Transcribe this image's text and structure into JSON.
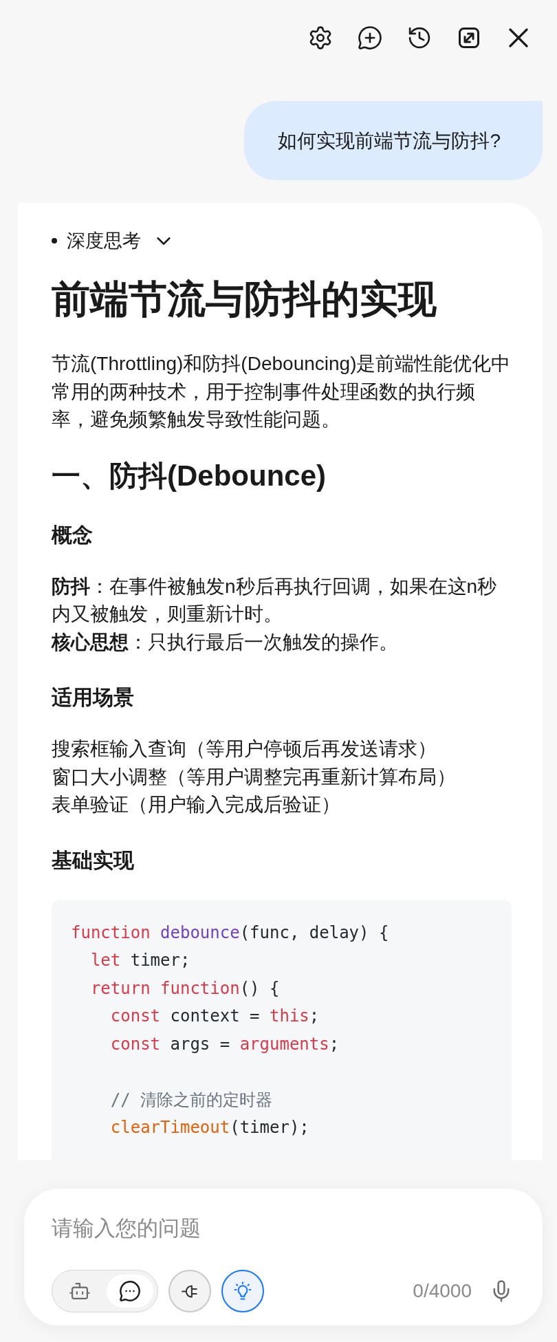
{
  "user_message": {
    "text": "如何实现前端节流与防抖?"
  },
  "answer": {
    "thinking": {
      "label": "深度思考",
      "expanded": false
    },
    "title": "前端节流与防抖的实现",
    "blocks": [
      {
        "kind": "paragraph",
        "text": "节流(Throttling)和防抖(Debouncing)是前端性能优化中常用的两种技术，用于控制事件处理函数的执行频率，避免频繁触发导致性能问题。"
      },
      {
        "kind": "h2",
        "text": "一、防抖(Debounce)"
      },
      {
        "kind": "h3",
        "text": "概念"
      },
      {
        "kind": "lines",
        "lines": [
          "**防抖**：在事件被触发n秒后再执行回调，如果在这n秒内又被触发，则重新计时。",
          "**核心思想**：只执行最后一次触发的操作。"
        ]
      },
      {
        "kind": "h3",
        "text": "适用场景"
      },
      {
        "kind": "lines",
        "lines": [
          "搜索框输入查询（等用户停顿后再发送请求）",
          "窗口大小调整（等用户调整完再重新计算布局）",
          "表单验证（用户输入完成后验证）"
        ]
      },
      {
        "kind": "h3",
        "text": "基础实现"
      },
      {
        "kind": "code",
        "lines": [
          {
            "kind": "code",
            "tokens": [
              {
                "text": "function",
                "kind": "keyword"
              },
              {
                "text": " debounce",
                "kind": "function"
              },
              {
                "text": "(func, delay) {",
                "kind": "plain"
              }
            ]
          },
          {
            "kind": "code",
            "tokens": [
              {
                "text": "  let",
                "kind": "keyword"
              },
              {
                "text": " timer;",
                "kind": "plain"
              }
            ]
          },
          {
            "kind": "code",
            "tokens": [
              {
                "text": "  return function",
                "kind": "keyword"
              },
              {
                "text": "() {",
                "kind": "plain"
              }
            ]
          },
          {
            "kind": "code",
            "tokens": [
              {
                "text": "    const",
                "kind": "keyword"
              },
              {
                "text": " context = ",
                "kind": "plain"
              },
              {
                "text": "this",
                "kind": "keyword"
              },
              {
                "text": ";",
                "kind": "plain"
              }
            ]
          },
          {
            "kind": "code",
            "tokens": [
              {
                "text": "    const",
                "kind": "keyword"
              },
              {
                "text": " args = ",
                "kind": "plain"
              },
              {
                "text": "arguments",
                "kind": "keyword"
              },
              {
                "text": ";",
                "kind": "plain"
              }
            ]
          },
          {
            "kind": "blank"
          },
          {
            "kind": "code",
            "tokens": [
              {
                "text": "    // 清除之前的定时器",
                "kind": "comment"
              }
            ]
          },
          {
            "kind": "code",
            "tokens": [
              {
                "text": "    clearTimeout",
                "kind": "builtin"
              },
              {
                "text": "(timer);",
                "kind": "plain"
              }
            ]
          }
        ]
      }
    ]
  },
  "composer": {
    "placeholder": "请输入您的问题",
    "modes": [
      {
        "kind": "robot",
        "selected": false
      },
      {
        "kind": "chat",
        "selected": true
      }
    ],
    "tools": [
      {
        "kind": "plug",
        "active": false
      },
      {
        "kind": "bulb",
        "active": true
      }
    ],
    "counter": "0/4000"
  }
}
